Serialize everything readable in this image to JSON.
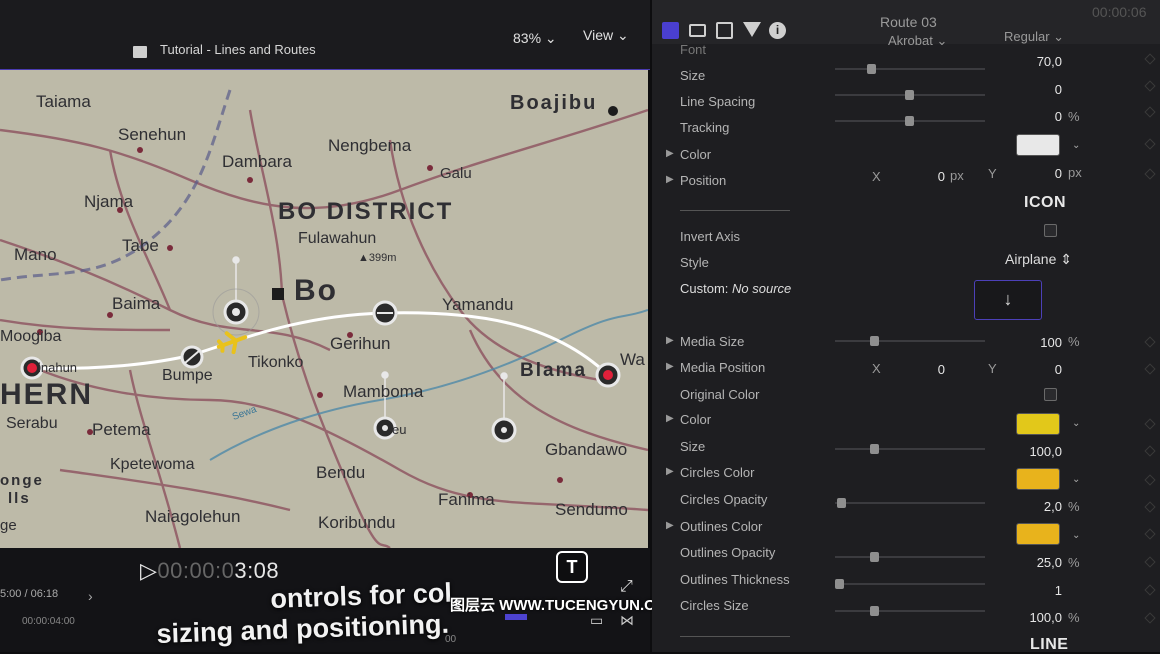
{
  "viewer": {
    "title": "Tutorial - Lines and Routes",
    "zoom": "83%",
    "view_menu": "View",
    "timecode_dim": "00:00:0",
    "timecode_main": "3:08",
    "time_position": "5:00 / 06:18",
    "time_small": "00:00:04:00",
    "ruler_small": "00"
  },
  "map": {
    "places": [
      "Taiama",
      "Senehun",
      "Boajibu",
      "Dambara",
      "Nengbema",
      "Galu",
      "Njama",
      "BO DISTRICT",
      "Fulawahun",
      "▲399m",
      "Mano",
      "Tabe",
      "Bo",
      "Baima",
      "Yamandu",
      "Moogiba",
      "Gerihun",
      "Bumpe",
      "Tikonko",
      "Blama",
      "HERN",
      "Mamboma",
      "Serabu",
      "Petema",
      "Gbandawo",
      "Kpetewoma",
      "Sewa",
      "Bendu",
      "Fanima",
      "Sendumo",
      "Naiagolehun",
      "Koribundu",
      "onge",
      "lls",
      "ge",
      "inahun",
      "eu",
      "Wa"
    ],
    "route_color": "#ffffff",
    "endpoint_color": "#e0203a",
    "plane_color": "#e9c21b"
  },
  "subtitle": {
    "line1": "ontrols for col",
    "line2": "sizing and positioning."
  },
  "watermark": {
    "text": "图层云 WWW.TUCENGYUN.COM",
    "logo": "T"
  },
  "inspector": {
    "title": "Route 03",
    "timecode": "00:00:06",
    "font_label": "Font",
    "font_value": "Akrobat",
    "font_weight": "Regular",
    "size_label": "Size",
    "size_value": "70,0",
    "line_spacing_label": "Line Spacing",
    "line_spacing_value": "0",
    "tracking_label": "Tracking",
    "tracking_value": "0",
    "tracking_unit": "%",
    "color_label": "Color",
    "position_label": "Position",
    "pos_x_label": "X",
    "pos_x_value": "0",
    "pos_y_label": "Y",
    "pos_y_value": "0",
    "px": "px",
    "icon_section": "ICON",
    "invert_axis_label": "Invert Axis",
    "style_label": "Style",
    "style_value": "Airplane",
    "custom_label": "Custom:",
    "custom_value": "No source",
    "media_size_label": "Media Size",
    "media_size_value": "100",
    "media_position_label": "Media Position",
    "mp_x_label": "X",
    "mp_x_value": "0",
    "mp_y_label": "Y",
    "mp_y_value": "0",
    "original_color_label": "Original Color",
    "color2_label": "Color",
    "size2_label": "Size",
    "size2_value": "100,0",
    "circles_color_label": "Circles Color",
    "circles_opacity_label": "Circles Opacity",
    "circles_opacity_value": "2,0",
    "outlines_color_label": "Outlines Color",
    "outlines_opacity_label": "Outlines Opacity",
    "outlines_opacity_value": "25,0",
    "outlines_thickness_label": "Outlines Thickness",
    "outlines_thickness_value": "1",
    "circles_size_label": "Circles Size",
    "circles_size_value": "100,0",
    "line_section": "LINE",
    "percent": "%",
    "text_color": "#e8e8e8",
    "icon_color": "#e2c81a",
    "circles_color": "#e8b31c",
    "outlines_color": "#e8b31c"
  }
}
